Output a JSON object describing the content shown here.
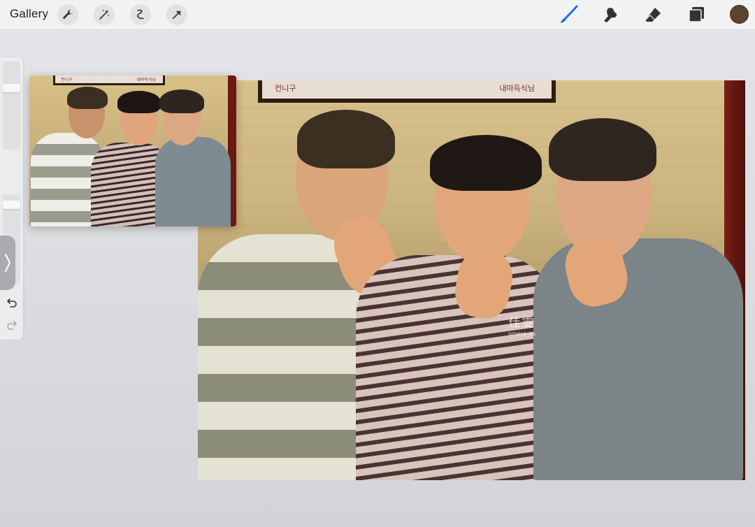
{
  "toolbar": {
    "gallery_label": "Gallery",
    "left_tools": [
      "wrench-icon",
      "magic-wand-icon",
      "selection-icon",
      "transform-arrow-icon"
    ],
    "right_tools": [
      "brush-icon",
      "smudge-icon",
      "eraser-icon",
      "layers-icon"
    ],
    "current_color": "#5b4530",
    "active_tool_color": "#1e73e8"
  },
  "sidebar": {
    "size_slider": 0.28,
    "opacity_slider": 0.08,
    "icons": [
      "modify-square-icon",
      "chevron-right-icon",
      "undo-icon",
      "redo-icon"
    ]
  },
  "canvas": {
    "frame_text_left": "컨니구",
    "frame_text_right": "내마득식님",
    "watermark_main": "佳雯",
    "watermark_sub": "omera_su"
  },
  "reference": {
    "frame_text_left": "컨니구",
    "frame_text_right": "내마득식님"
  }
}
